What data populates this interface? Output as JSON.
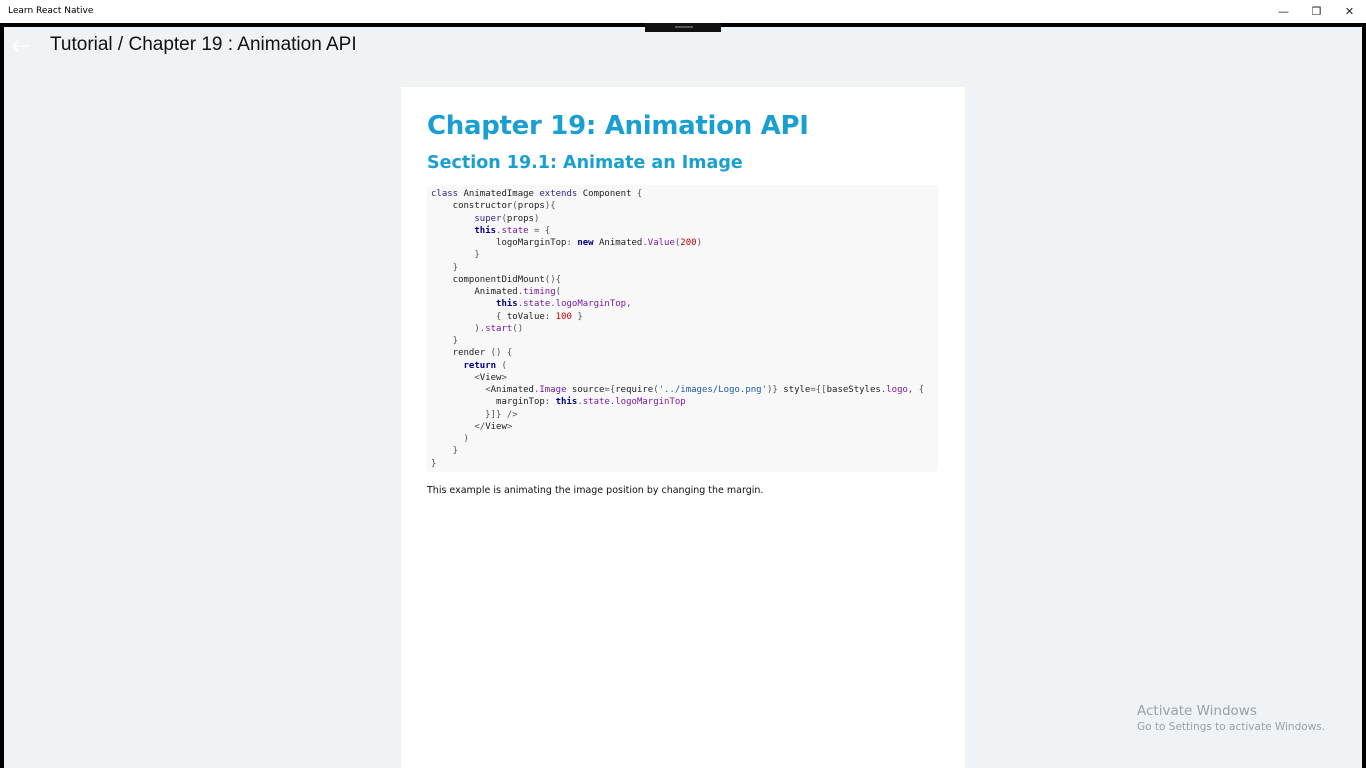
{
  "window": {
    "title": "Learn React Native",
    "minimize_glyph": "—",
    "restore_glyph": "❐",
    "close_glyph": "✕"
  },
  "header": {
    "back_icon": "back-arrow-icon",
    "title": "Tutorial / Chapter 19 :  Animation API"
  },
  "content": {
    "chapter_title": "Chapter 19: Animation API",
    "section_title": "Section 19.1: Animate an Image",
    "code_lines": [
      [
        {
          "t": "class ",
          "c": "kw"
        },
        {
          "t": "AnimatedImage "
        },
        {
          "t": "extends ",
          "c": "kw"
        },
        {
          "t": "Component "
        },
        {
          "t": "{",
          "c": "punct"
        }
      ],
      [
        {
          "t": "    constructor"
        },
        {
          "t": "(",
          "c": "punct"
        },
        {
          "t": "props"
        },
        {
          "t": "){",
          "c": "punct"
        }
      ],
      [
        {
          "t": "        "
        },
        {
          "t": "super",
          "c": "kw"
        },
        {
          "t": "(",
          "c": "punct"
        },
        {
          "t": "props"
        },
        {
          "t": ")",
          "c": "punct"
        }
      ],
      [
        {
          "t": "        "
        },
        {
          "t": "this",
          "c": "kwb"
        },
        {
          "t": ".",
          "c": "punct"
        },
        {
          "t": "state",
          "c": "prop"
        },
        {
          "t": " = {",
          "c": "punct"
        }
      ],
      [
        {
          "t": "            logoMarginTop"
        },
        {
          "t": ": ",
          "c": "punct"
        },
        {
          "t": "new ",
          "c": "kwb"
        },
        {
          "t": "Animated"
        },
        {
          "t": ".",
          "c": "punct"
        },
        {
          "t": "Value",
          "c": "fn"
        },
        {
          "t": "(",
          "c": "punct"
        },
        {
          "t": "200",
          "c": "num"
        },
        {
          "t": ")",
          "c": "punct"
        }
      ],
      [
        {
          "t": "        }",
          "c": "punct"
        }
      ],
      [
        {
          "t": "    }",
          "c": "punct"
        }
      ],
      [
        {
          "t": "    componentDidMount"
        },
        {
          "t": "(){",
          "c": "punct"
        }
      ],
      [
        {
          "t": "        Animated"
        },
        {
          "t": ".",
          "c": "punct"
        },
        {
          "t": "timing",
          "c": "fn"
        },
        {
          "t": "(",
          "c": "punct"
        }
      ],
      [
        {
          "t": "            "
        },
        {
          "t": "this",
          "c": "kwb"
        },
        {
          "t": ".",
          "c": "punct"
        },
        {
          "t": "state",
          "c": "prop"
        },
        {
          "t": ".",
          "c": "punct"
        },
        {
          "t": "logoMarginTop",
          "c": "prop"
        },
        {
          "t": ",",
          "c": "punct"
        }
      ],
      [
        {
          "t": "            { ",
          "c": "punct"
        },
        {
          "t": "toValue"
        },
        {
          "t": ": ",
          "c": "punct"
        },
        {
          "t": "100",
          "c": "num"
        },
        {
          "t": " }",
          "c": "punct"
        }
      ],
      [
        {
          "t": "        )",
          "c": "punct"
        },
        {
          "t": ".",
          "c": "punct"
        },
        {
          "t": "start",
          "c": "fn"
        },
        {
          "t": "()",
          "c": "punct"
        }
      ],
      [
        {
          "t": "    }",
          "c": "punct"
        }
      ],
      [
        {
          "t": "    render "
        },
        {
          "t": "() {",
          "c": "punct"
        }
      ],
      [
        {
          "t": "      "
        },
        {
          "t": "return ",
          "c": "kwb"
        },
        {
          "t": "(",
          "c": "punct"
        }
      ],
      [
        {
          "t": "        "
        },
        {
          "t": "<",
          "c": "punct"
        },
        {
          "t": "View"
        },
        {
          "t": ">",
          "c": "punct"
        }
      ],
      [
        {
          "t": "          "
        },
        {
          "t": "<",
          "c": "punct"
        },
        {
          "t": "Animated"
        },
        {
          "t": ".",
          "c": "punct"
        },
        {
          "t": "Image",
          "c": "fn"
        },
        {
          "t": " source"
        },
        {
          "t": "={",
          "c": "punct"
        },
        {
          "t": "require"
        },
        {
          "t": "(",
          "c": "punct"
        },
        {
          "t": "'../images/Logo.png'",
          "c": "str"
        },
        {
          "t": ")}",
          "c": "punct"
        },
        {
          "t": " style"
        },
        {
          "t": "={[",
          "c": "punct"
        },
        {
          "t": "baseStyles"
        },
        {
          "t": ".",
          "c": "punct"
        },
        {
          "t": "logo",
          "c": "prop"
        },
        {
          "t": ", {",
          "c": "punct"
        }
      ],
      [
        {
          "t": "            marginTop"
        },
        {
          "t": ": ",
          "c": "punct"
        },
        {
          "t": "this",
          "c": "kwb"
        },
        {
          "t": ".",
          "c": "punct"
        },
        {
          "t": "state",
          "c": "prop"
        },
        {
          "t": ".",
          "c": "punct"
        },
        {
          "t": "logoMarginTop",
          "c": "prop"
        }
      ],
      [
        {
          "t": "          }]} />",
          "c": "punct"
        }
      ],
      [
        {
          "t": "        </",
          "c": "punct"
        },
        {
          "t": "View"
        },
        {
          "t": ">",
          "c": "punct"
        }
      ],
      [
        {
          "t": "      )",
          "c": "punct"
        }
      ],
      [
        {
          "t": "    }",
          "c": "punct"
        }
      ],
      [
        {
          "t": "}",
          "c": "punct"
        }
      ]
    ],
    "description": "This example is animating the image position by changing the margin."
  },
  "watermark": {
    "title": "Activate Windows",
    "subtitle": "Go to Settings to activate Windows."
  }
}
